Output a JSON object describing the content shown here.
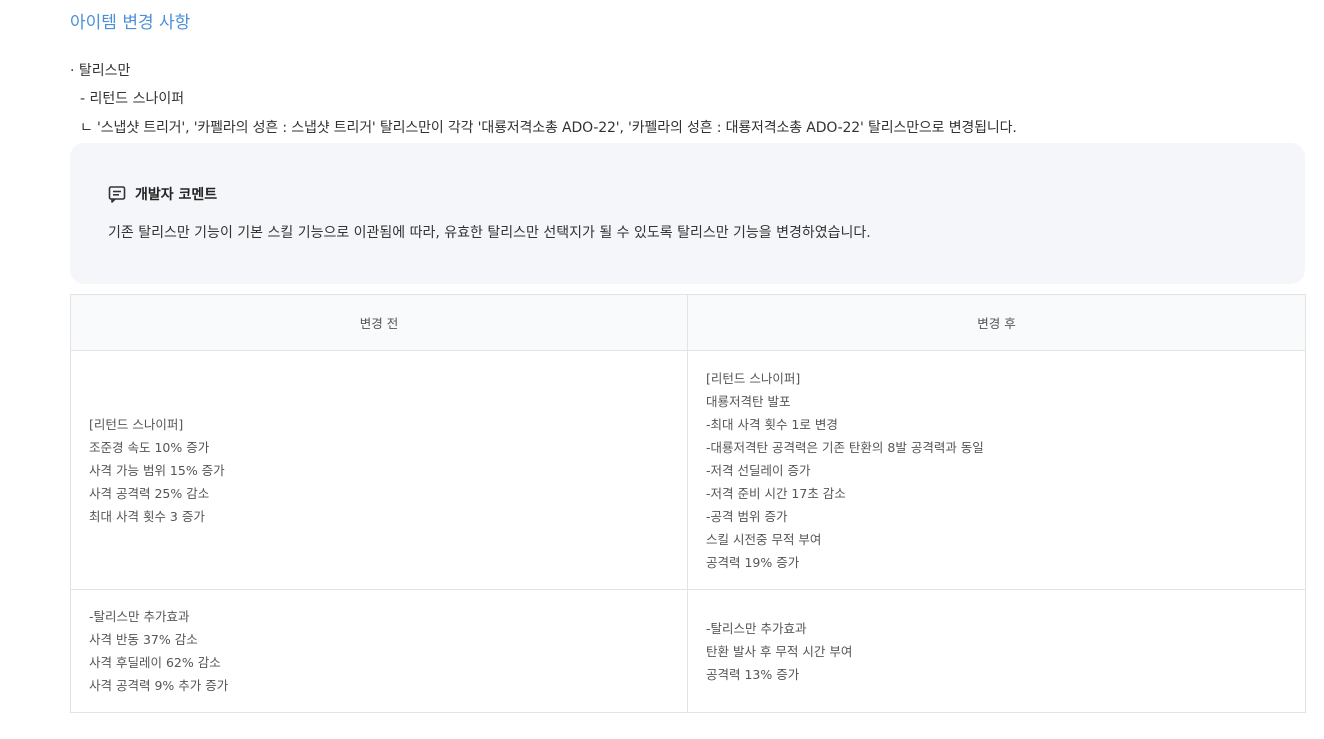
{
  "section": {
    "title": "아이템 변경 사항"
  },
  "notes": {
    "item": "· 탈리스만",
    "sub_item": "- 리턴드 스나이퍼",
    "detail": "ㄴ '스냅샷 트리거', '카펠라의 성흔 : 스냅샷 트리거' 탈리스만이 각각 '대룡저격소총 ADO-22', '카펠라의 성흔 : 대룡저격소총 ADO-22' 탈리스만으로 변경됩니다."
  },
  "dev_comment": {
    "icon": "comment-icon",
    "title": "개발자 코멘트",
    "text": "기존 탈리스만 기능이 기본 스킬 기능으로 이관됨에 따라, 유효한 탈리스만 선택지가 될 수 있도록 탈리스만 기능을 변경하였습니다."
  },
  "table": {
    "headers": [
      "변경 전",
      "변경 후"
    ],
    "rows": [
      {
        "before": [
          "[리턴드 스나이퍼]",
          "조준경 속도 10% 증가",
          "사격 가능 범위 15% 증가",
          "사격 공격력 25% 감소",
          "최대 사격 횟수 3 증가"
        ],
        "after": [
          "[리턴드 스나이퍼]",
          "대룡저격탄 발포",
          "-최대 사격 횟수 1로 변경",
          "-대룡저격탄 공격력은 기존 탄환의 8발 공격력과 동일",
          "-저격 선딜레이 증가",
          "-저격 준비 시간 17초 감소",
          "-공격 범위 증가",
          "스킬 시전중 무적 부여",
          "공격력 19% 증가"
        ]
      },
      {
        "before": [
          "-탈리스만 추가효과",
          "사격 반동 37% 감소",
          "사격 후딜레이 62% 감소",
          "사격 공격력 9% 추가 증가"
        ],
        "after": [
          "-탈리스만 추가효과",
          "탄환 발사 후 무적 시간 부여",
          "공격력 13% 증가"
        ]
      }
    ]
  }
}
